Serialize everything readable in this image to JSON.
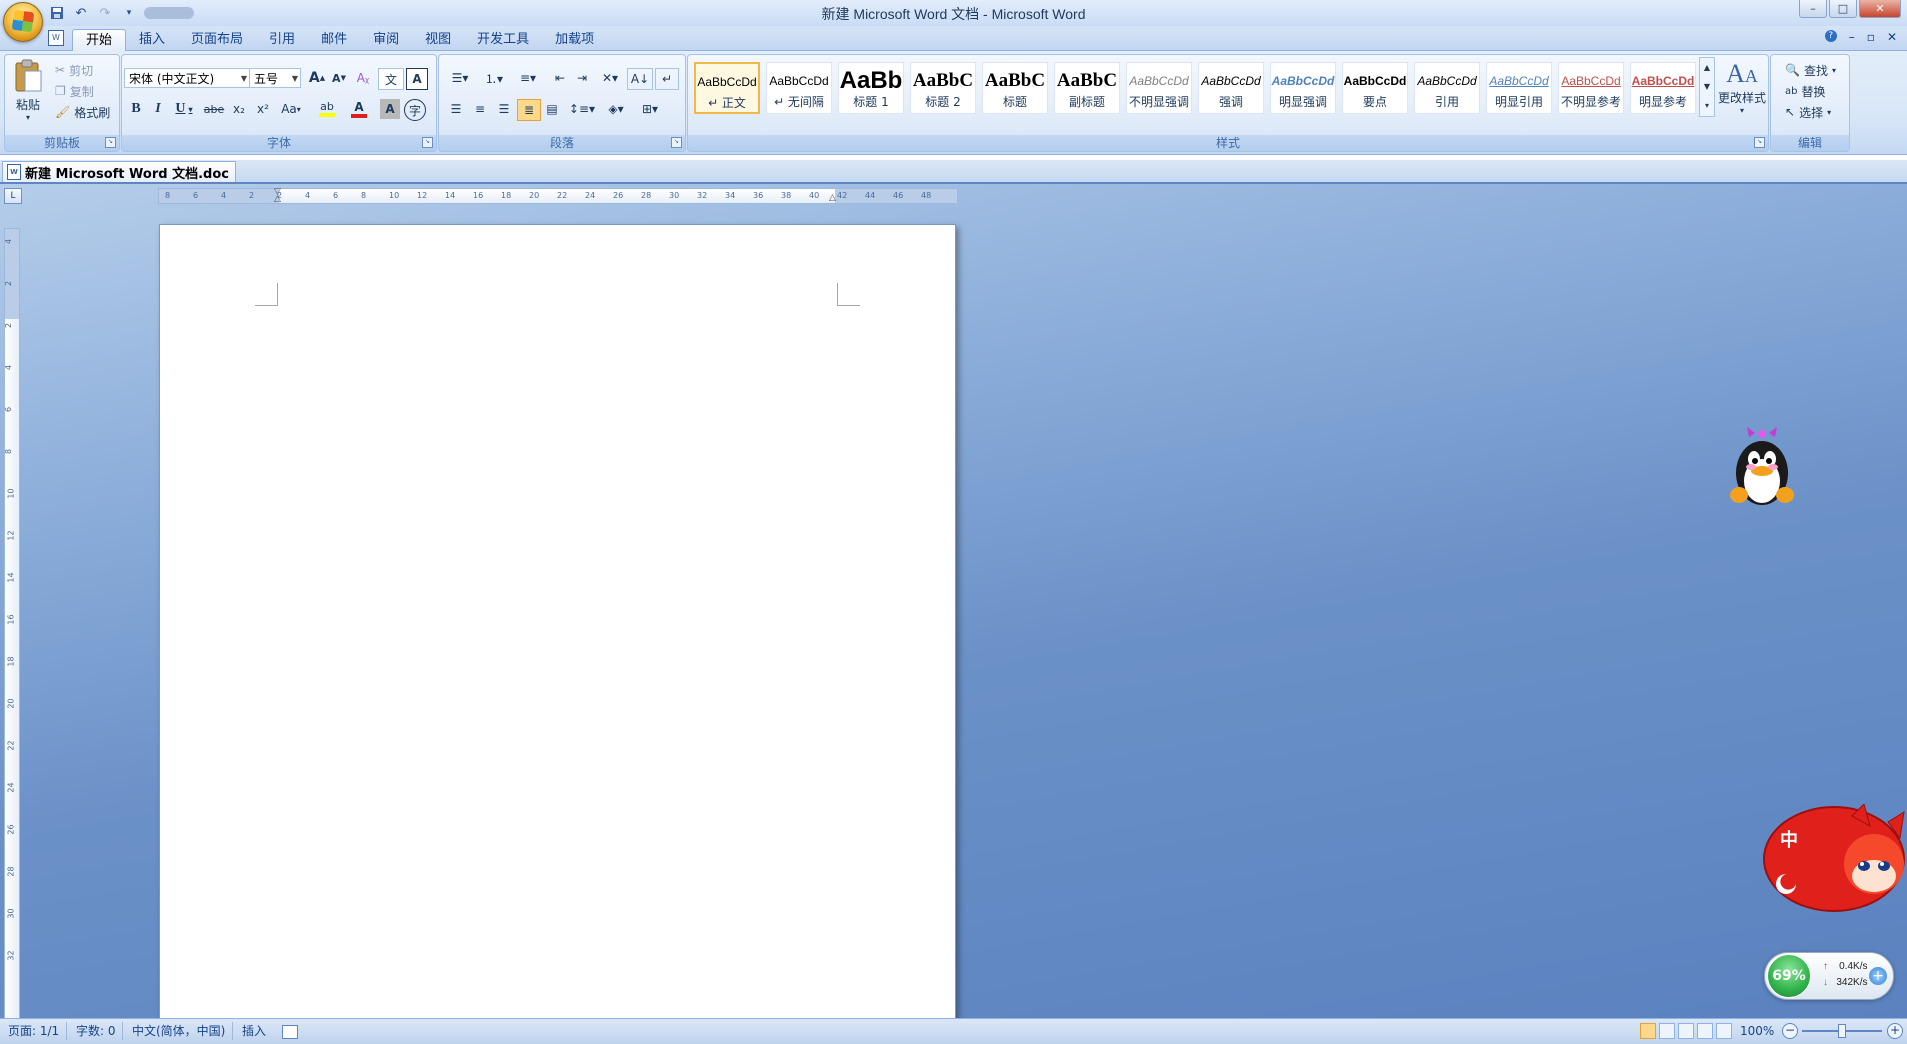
{
  "window": {
    "title": "新建 Microsoft Word 文档 - Microsoft Word",
    "controls": [
      "–",
      "□",
      "✕"
    ]
  },
  "quick_access": {
    "icons": [
      "save-icon",
      "undo-icon",
      "redo-icon",
      "customize-icon"
    ]
  },
  "tabs": [
    {
      "label": "开始",
      "active": true
    },
    {
      "label": "插入"
    },
    {
      "label": "页面布局"
    },
    {
      "label": "引用"
    },
    {
      "label": "邮件"
    },
    {
      "label": "审阅"
    },
    {
      "label": "视图"
    },
    {
      "label": "开发工具"
    },
    {
      "label": "加载项"
    }
  ],
  "ribbon_right": {
    "help": "?",
    "minimize": "–",
    "restore": "▫",
    "close": "✕"
  },
  "clipboard": {
    "group_label": "剪贴板",
    "paste": "粘贴",
    "cut": "剪切",
    "copy": "复制",
    "format_painter": "格式刷"
  },
  "font": {
    "group_label": "字体",
    "font_name": "宋体 (中文正文)",
    "font_size": "五号",
    "grow": "A",
    "shrink": "A",
    "bold": "B",
    "italic": "I",
    "underline": "U",
    "strike": "abe",
    "subscript": "x₂",
    "superscript": "x²",
    "change_case": "Aa",
    "font_color": "A",
    "char_shading": "A",
    "pinyin": "文",
    "clear": "A",
    "enclose": "字"
  },
  "paragraph": {
    "group_label": "段落"
  },
  "styles": {
    "group_label": "样式",
    "change_styles": "更改样式",
    "items": [
      {
        "sample": "AaBbCcDd",
        "name": "↵ 正文",
        "selected": true
      },
      {
        "sample": "AaBbCcDd",
        "name": "↵ 无间隔"
      },
      {
        "sample": "AaBb",
        "name": "标题 1"
      },
      {
        "sample": "AaBbC",
        "name": "标题 2"
      },
      {
        "sample": "AaBbC",
        "name": "标题"
      },
      {
        "sample": "AaBbC",
        "name": "副标题"
      },
      {
        "sample": "AaBbCcDd",
        "name": "不明显强调"
      },
      {
        "sample": "AaBbCcDd",
        "name": "强调"
      },
      {
        "sample": "AaBbCcDd",
        "name": "明显强调"
      },
      {
        "sample": "AaBbCcDd",
        "name": "要点"
      },
      {
        "sample": "AaBbCcDd",
        "name": "引用"
      },
      {
        "sample": "AaBbCcDd",
        "name": "明显引用"
      },
      {
        "sample": "AaBbCcDd",
        "name": "不明显参考"
      },
      {
        "sample": "AaBbCcDd",
        "name": "明显参考"
      }
    ]
  },
  "editing": {
    "group_label": "编辑",
    "find": "查找",
    "replace": "替换",
    "select": "选择"
  },
  "document_tab": "新建 Microsoft Word 文档.doc",
  "ruler": {
    "corner": "L",
    "h_labels": [
      "8",
      "6",
      "4",
      "2",
      "2",
      "4",
      "6",
      "8",
      "10",
      "12",
      "14",
      "16",
      "18",
      "20",
      "22",
      "24",
      "26",
      "28",
      "30",
      "32",
      "34",
      "36",
      "38",
      "40",
      "42",
      "44",
      "46",
      "48"
    ],
    "v_labels": [
      "4",
      "2",
      "2",
      "4",
      "6",
      "8",
      "10",
      "12",
      "14",
      "16",
      "18",
      "20",
      "22",
      "24",
      "26",
      "28",
      "30",
      "32"
    ]
  },
  "netmon": {
    "percent": "69%",
    "up": "0.4K/s",
    "down": "342K/s",
    "plus": "+"
  },
  "fox_badge": "中",
  "status": {
    "page": "页面: 1/1",
    "words": "字数: 0",
    "language": "中文(简体，中国)",
    "mode": "插入",
    "zoom": "100%"
  },
  "colors": {
    "accent": "#15428b",
    "ribbon_bg": "#d6e5f7",
    "workspace": "#6b91c8",
    "selected_style": "#f0b74a",
    "font_color_bar": "#e0201b",
    "highlight_bar": "#ffff00"
  }
}
